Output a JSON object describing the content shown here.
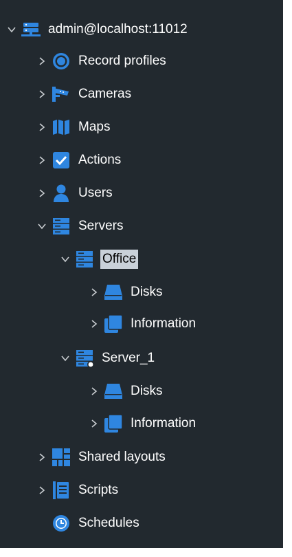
{
  "tree": {
    "root": {
      "label": "admin@localhost:11012",
      "icon": "server-connection-icon",
      "expanded": true
    },
    "items": [
      {
        "label": "Record profiles",
        "icon": "record-profile-icon",
        "expanded": false
      },
      {
        "label": "Cameras",
        "icon": "camera-icon",
        "expanded": false
      },
      {
        "label": "Maps",
        "icon": "map-icon",
        "expanded": false
      },
      {
        "label": "Actions",
        "icon": "checkbox-icon",
        "expanded": false
      },
      {
        "label": "Users",
        "icon": "user-icon",
        "expanded": false
      },
      {
        "label": "Servers",
        "icon": "servers-icon",
        "expanded": true
      },
      {
        "label": "Office",
        "icon": "server-icon",
        "expanded": true,
        "selected": true
      },
      {
        "label": "Disks",
        "icon": "disk-icon",
        "expanded": false
      },
      {
        "label": "Information",
        "icon": "information-icon",
        "expanded": false
      },
      {
        "label": "Server_1",
        "icon": "server-online-icon",
        "expanded": true
      },
      {
        "label": "Disks",
        "icon": "disk-icon",
        "expanded": false
      },
      {
        "label": "Information",
        "icon": "information-icon",
        "expanded": false
      },
      {
        "label": "Shared layouts",
        "icon": "layout-icon",
        "expanded": false
      },
      {
        "label": "Scripts",
        "icon": "script-icon",
        "expanded": false
      },
      {
        "label": "Schedules",
        "icon": "schedule-icon",
        "expanded": null
      }
    ]
  },
  "colors": {
    "panel_bg": "#22292f",
    "icon_blue": "#2f86e0",
    "text": "#ffffff",
    "selection_bg": "#c9d1d9"
  }
}
